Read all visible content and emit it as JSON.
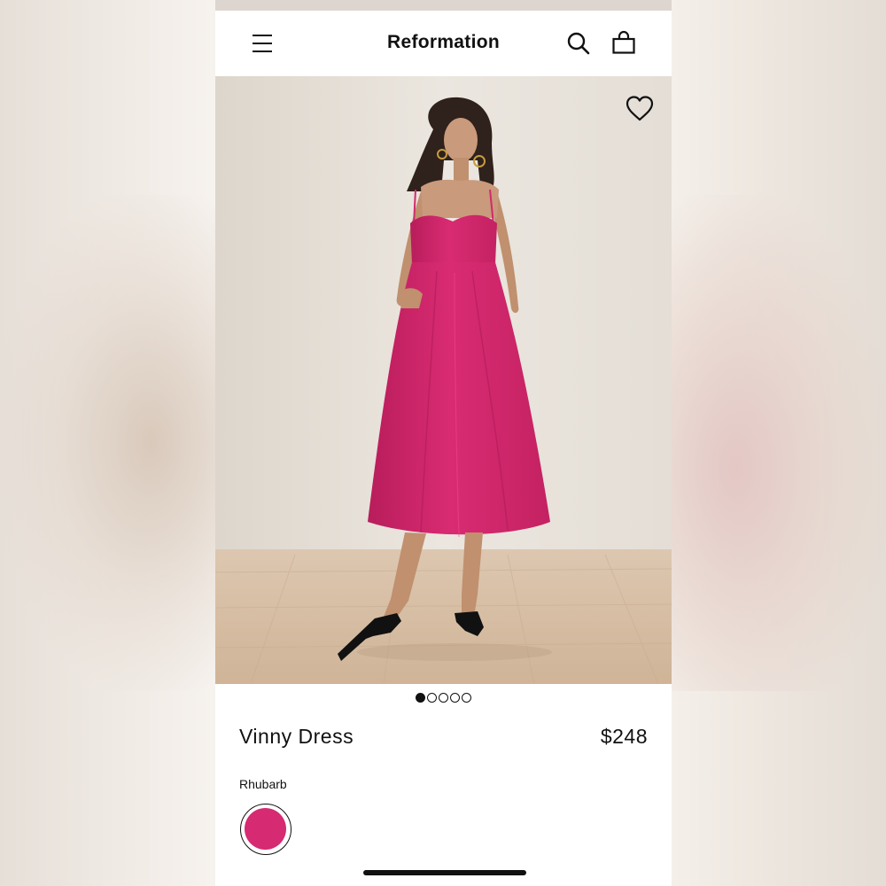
{
  "header": {
    "brand": "Reformation",
    "menu_icon": "hamburger-menu-icon",
    "search_icon": "search-icon",
    "bag_icon": "shopping-bag-icon"
  },
  "gallery": {
    "image_subject": "model in pink midi dress",
    "favorite_icon": "heart-icon",
    "image_count": 5,
    "active_index": 0
  },
  "product": {
    "name": "Vinny Dress",
    "price": "$248",
    "color_label": "Rhubarb",
    "swatch_color": "#d62a72"
  },
  "colors": {
    "dress": "#d4286e",
    "wall": "#e9e4dc",
    "floor": "#d6bfa6"
  }
}
